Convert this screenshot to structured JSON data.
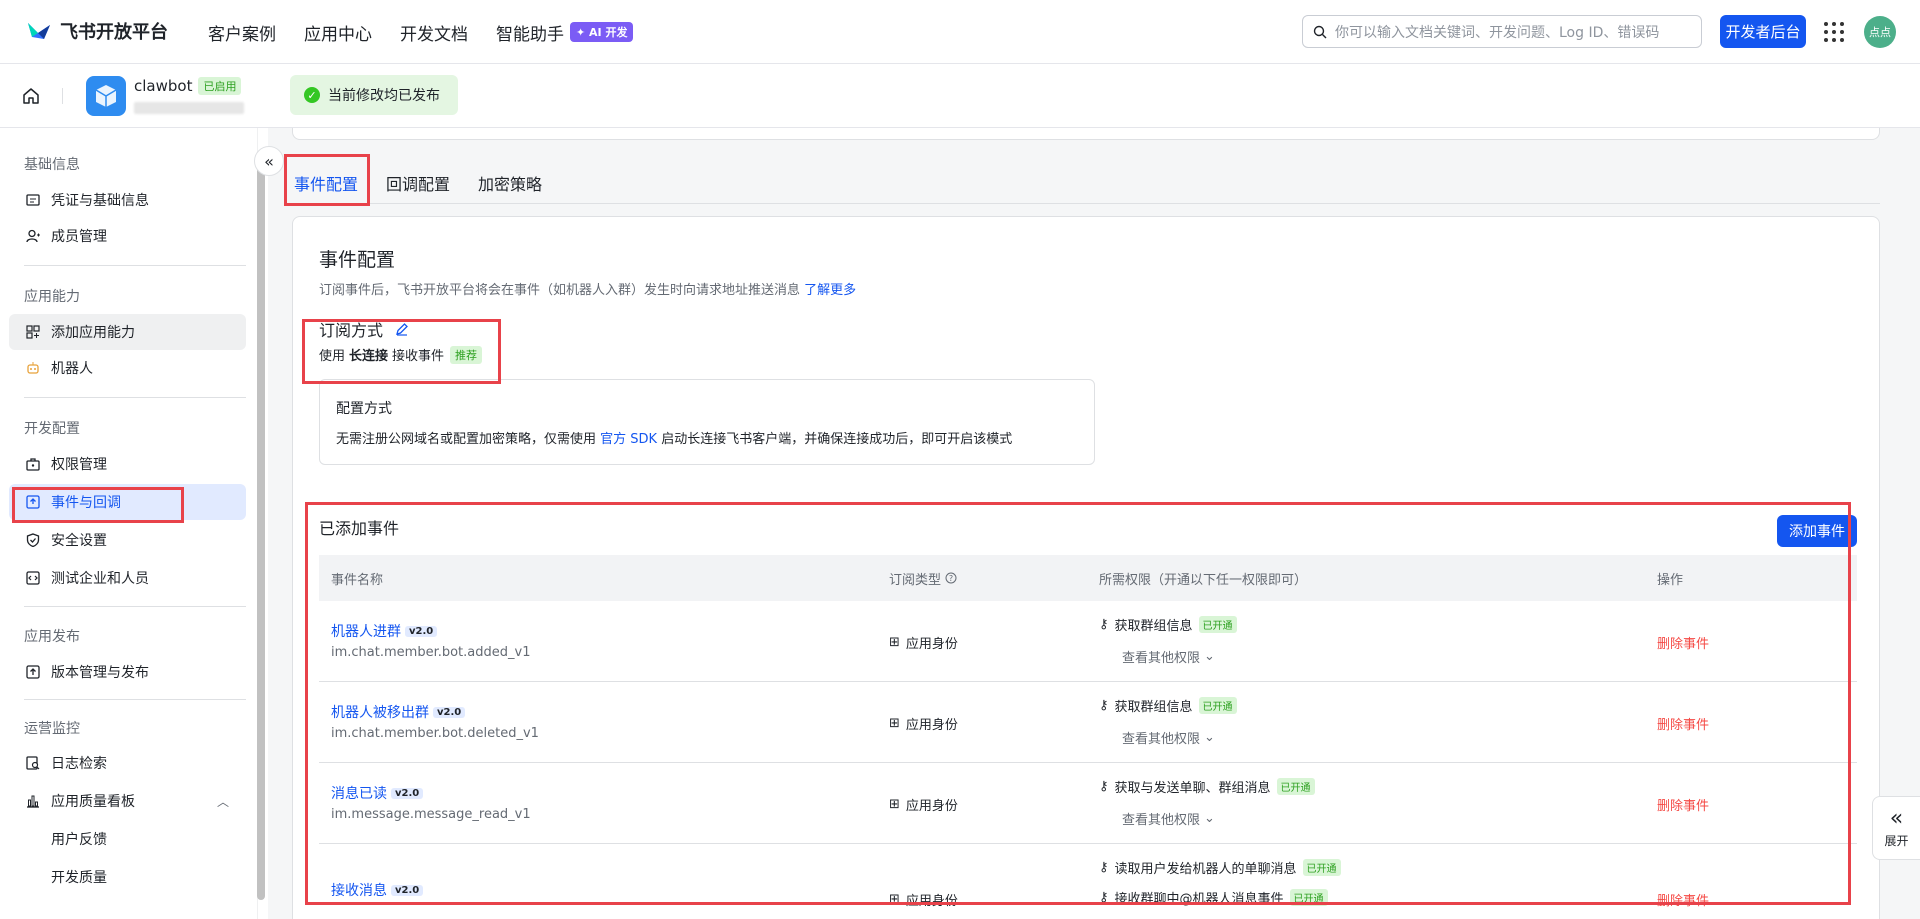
{
  "header": {
    "logo_text": "飞书开放平台",
    "nav": [
      "客户案例",
      "应用中心",
      "开发文档",
      "智能助手"
    ],
    "ai_badge": "✦ AI 开发",
    "search_placeholder": "你可以输入文档关键词、开发问题、Log ID、错误码",
    "dev_console": "开发者后台",
    "avatar_text": "点点"
  },
  "app": {
    "name": "clawbot",
    "status": "已启用",
    "publish_notice": "当前修改均已发布"
  },
  "sidebar": {
    "groups": [
      "基础信息",
      "应用能力",
      "开发配置",
      "应用发布",
      "运营监控"
    ],
    "items": [
      "凭证与基础信息",
      "成员管理",
      "添加应用能力",
      "机器人",
      "权限管理",
      "事件与回调",
      "安全设置",
      "测试企业和人员",
      "版本管理与发布",
      "日志检索",
      "应用质量看板",
      "用户反馈",
      "开发质量"
    ]
  },
  "tabs": [
    "事件配置",
    "回调配置",
    "加密策略"
  ],
  "event_config": {
    "title": "事件配置",
    "desc": "订阅事件后，飞书开放平台将会在事件（如机器人入群）发生时向请求地址推送消息",
    "learn_more": "了解更多",
    "sub_title": "订阅方式",
    "sub_prefix": "使用",
    "sub_method": "长连接",
    "sub_suffix": "接收事件",
    "recommend": "推荐",
    "cfg_title": "配置方式",
    "cfg_desc_1": "无需注册公网域名或配置加密策略，仅需使用",
    "cfg_sdk": "官方 SDK",
    "cfg_desc_2": "启动长连接飞书客户端，并确保连接成功后，即可开启该模式"
  },
  "events": {
    "title": "已添加事件",
    "add_button": "添加事件",
    "columns": [
      "事件名称",
      "订阅类型",
      "所需权限（开通以下任一权限即可）",
      "操作"
    ],
    "rows": [
      {
        "name": "机器人进群",
        "ver": "v2.0",
        "code": "im.chat.member.bot.added_v1",
        "type": "应用身份",
        "perm": "获取群组信息",
        "perm_status": "已开通",
        "more": "查看其他权限",
        "action": "删除事件"
      },
      {
        "name": "机器人被移出群",
        "ver": "v2.0",
        "code": "im.chat.member.bot.deleted_v1",
        "type": "应用身份",
        "perm": "获取群组信息",
        "perm_status": "已开通",
        "more": "查看其他权限",
        "action": "删除事件"
      },
      {
        "name": "消息已读",
        "ver": "v2.0",
        "code": "im.message.message_read_v1",
        "type": "应用身份",
        "perm": "获取与发送单聊、群组消息",
        "perm_status": "已开通",
        "more": "查看其他权限",
        "action": "删除事件"
      },
      {
        "name": "接收消息",
        "ver": "v2.0",
        "code": "",
        "type": "应用身份",
        "perm": "读取用户发给机器人的单聊消息",
        "perm_status": "已开通",
        "perm2": "接收群聊中@机器人消息事件",
        "perm2_status": "已开通",
        "action": "删除事件"
      }
    ]
  },
  "expand_label": "展开"
}
